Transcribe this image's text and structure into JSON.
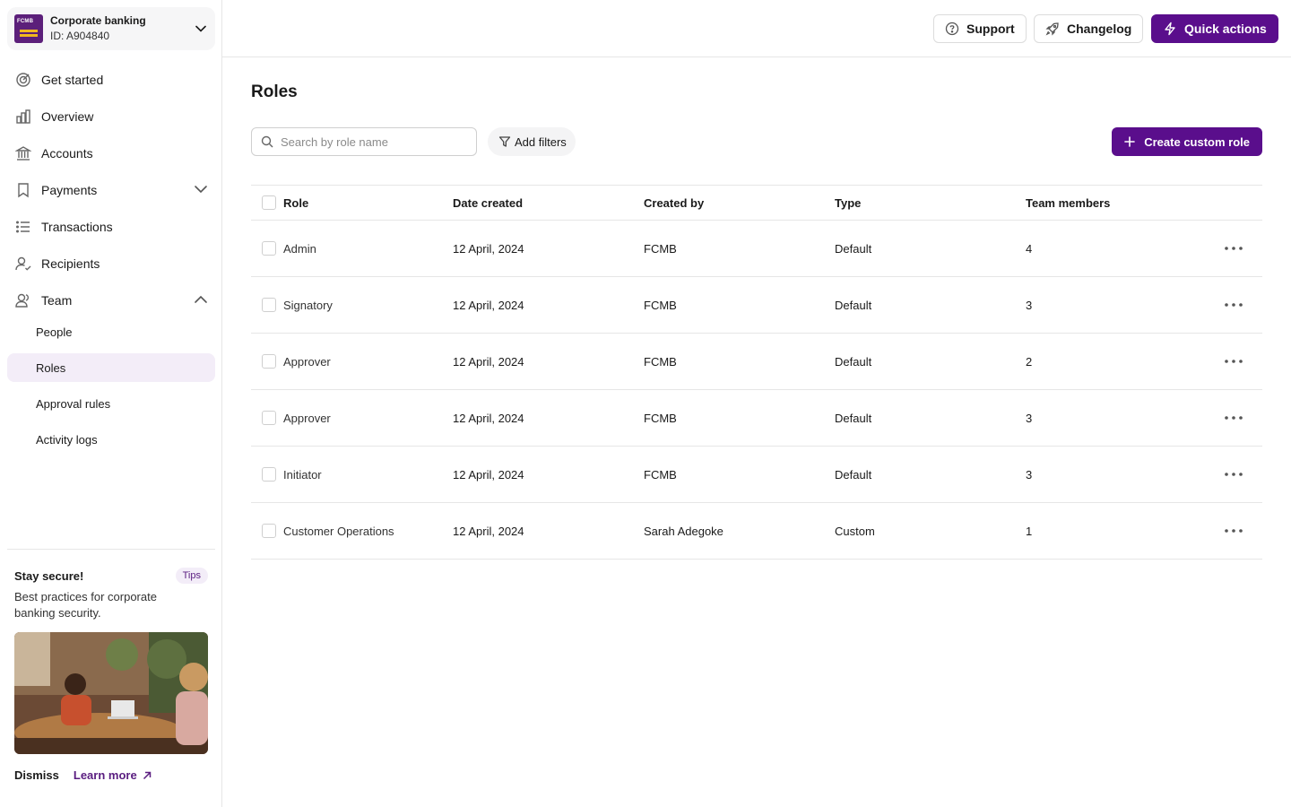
{
  "org": {
    "name": "Corporate banking",
    "id": "ID: A904840",
    "logo_text": "FCMB"
  },
  "nav": {
    "items": [
      {
        "key": "get-started",
        "label": "Get started",
        "icon": "target-icon"
      },
      {
        "key": "overview",
        "label": "Overview",
        "icon": "bar-chart-icon"
      },
      {
        "key": "accounts",
        "label": "Accounts",
        "icon": "bank-icon"
      },
      {
        "key": "payments",
        "label": "Payments",
        "icon": "bookmark-icon"
      },
      {
        "key": "transactions",
        "label": "Transactions",
        "icon": "list-icon"
      },
      {
        "key": "recipients",
        "label": "Recipients",
        "icon": "user-check-icon"
      },
      {
        "key": "team",
        "label": "Team",
        "icon": "users-icon"
      }
    ],
    "team_subitems": [
      "People",
      "Roles",
      "Approval rules",
      "Activity logs"
    ],
    "active_subitem": "Roles"
  },
  "tips": {
    "title": "Stay secure!",
    "badge": "Tips",
    "description": "Best practices for corporate banking security.",
    "dismiss_label": "Dismiss",
    "learn_more_label": "Learn more"
  },
  "topbar": {
    "support_label": "Support",
    "changelog_label": "Changelog",
    "quick_actions_label": "Quick actions"
  },
  "page": {
    "title": "Roles",
    "search_placeholder": "Search by role name",
    "add_filters_label": "Add filters",
    "create_label": "Create custom role"
  },
  "table": {
    "columns": [
      "Role",
      "Date created",
      "Created by",
      "Type",
      "Team members"
    ],
    "rows": [
      [
        "Admin",
        "12 April, 2024",
        "FCMB",
        "Default",
        "4"
      ],
      [
        "Signatory",
        "12 April, 2024",
        "FCMB",
        "Default",
        "3"
      ],
      [
        "Approver",
        "12 April, 2024",
        "FCMB",
        "Default",
        "2"
      ],
      [
        "Approver",
        "12 April, 2024",
        "FCMB",
        "Default",
        "3"
      ],
      [
        "Initiator",
        "12 April, 2024",
        "FCMB",
        "Default",
        "3"
      ],
      [
        "Customer Operations",
        "12 April, 2024",
        "Sarah Adegoke",
        "Custom",
        "1"
      ]
    ]
  },
  "colors": {
    "accent": "#5a0e8c",
    "active_bg": "#f3edf8",
    "border": "#e6e6e6"
  }
}
